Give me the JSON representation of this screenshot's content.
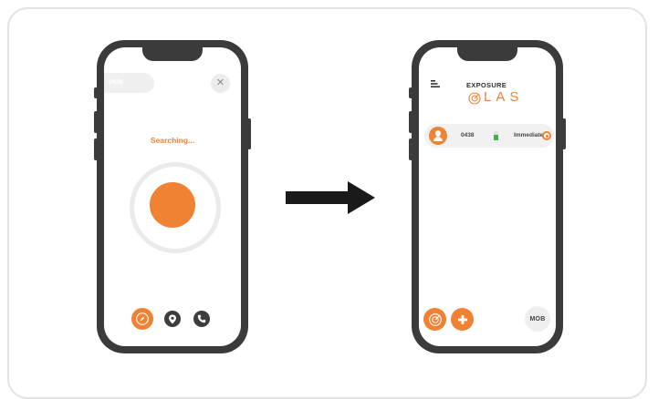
{
  "phone_left": {
    "device_id": "0438",
    "status_text": "Searching...",
    "close_glyph": "✕",
    "nav": [
      "compass-icon",
      "location-pin-icon",
      "phone-icon"
    ]
  },
  "phone_right": {
    "logo_top": "EXPOSURE",
    "logo_bottom": "LAS",
    "row": {
      "id": "0438",
      "status": "Immediate",
      "battery_level": 0.6
    },
    "mob_label": "MOB",
    "fabs": [
      "radar-icon",
      "plus-icon"
    ]
  },
  "colors": {
    "accent": "#f08234",
    "frame": "#3b3b3b",
    "battery": "#39b54a",
    "arrow": "#1a1a1a"
  }
}
